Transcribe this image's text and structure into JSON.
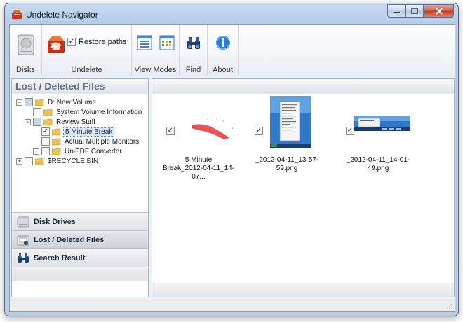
{
  "window": {
    "title": "Undelete Navigator",
    "accent": "#1f3d6d"
  },
  "ribbon": {
    "groups": {
      "disks": {
        "label": "Disks"
      },
      "undelete": {
        "label": "Undelete",
        "restore_paths_label": "Restore paths",
        "restore_paths_checked": true
      },
      "view_modes": {
        "label": "View Modes"
      },
      "find": {
        "label": "Find"
      },
      "about": {
        "label": "About"
      }
    }
  },
  "left_panel": {
    "title": "Lost / Deleted Files",
    "tree": [
      {
        "label": "D: New Volume",
        "expander": "−",
        "checked": false
      },
      {
        "label": "System Volume Information",
        "expander": "",
        "checked": false
      },
      {
        "label": "Review Stuff",
        "expander": "−",
        "checked": false
      },
      {
        "label": "5 Minute Break",
        "expander": "",
        "checked": true,
        "selected": true
      },
      {
        "label": "Actual Multiple Monitors",
        "expander": "",
        "checked": false
      },
      {
        "label": "UniPDF Converter",
        "expander": "+",
        "checked": false
      },
      {
        "label": "$RECYCLE.BIN",
        "expander": "+",
        "checked": false
      }
    ],
    "nav": {
      "disk_drives": "Disk Drives",
      "lost_deleted": "Lost / Deleted Files",
      "search_result": "Search Result"
    }
  },
  "files": [
    {
      "name": "5 Minute Break_2012-04-11_14-07...",
      "name_line1": "5 Minute",
      "name_line2": "Break_2012-04-11_14-07...",
      "checked": true
    },
    {
      "name": "_2012-04-11_13-57-59.png",
      "checked": true
    },
    {
      "name": "_2012-04-11_14-01-49.png",
      "checked": true
    }
  ],
  "check_mark": "✓"
}
